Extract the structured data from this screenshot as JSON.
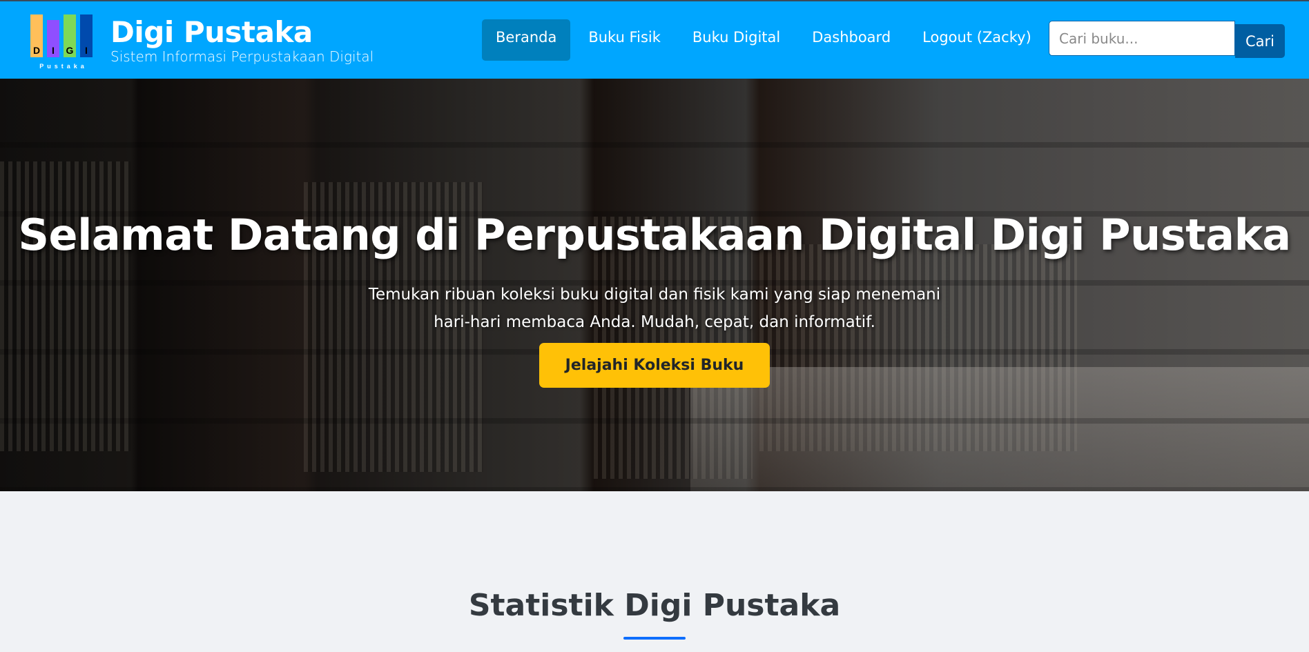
{
  "nav": {
    "logo": {
      "letters": [
        "D",
        "I",
        "G",
        "I"
      ],
      "sub": "Pustaka",
      "colors": [
        "#ffbf5a",
        "#8f4fff",
        "#7ed957",
        "#004aad"
      ]
    },
    "brand_title": "Digi Pustaka",
    "brand_subtitle": "Sistem Informasi Perpustakaan Digital",
    "menu": [
      {
        "label": "Beranda",
        "active": true
      },
      {
        "label": "Buku Fisik"
      },
      {
        "label": "Buku Digital"
      },
      {
        "label": "Dashboard"
      },
      {
        "label": "Logout (Zacky)"
      }
    ],
    "search": {
      "placeholder": "Cari buku...",
      "value": "",
      "button": "Cari"
    }
  },
  "hero": {
    "title": "Selamat Datang di Perpustakaan Digital Digi Pustaka",
    "text": "Temukan ribuan koleksi buku digital dan fisik kami yang siap menemani hari-hari membaca Anda. Mudah, cepat, dan informatif.",
    "cta": "Jelajahi Koleksi Buku"
  },
  "stats": {
    "title": "Statistik Digi Pustaka"
  }
}
